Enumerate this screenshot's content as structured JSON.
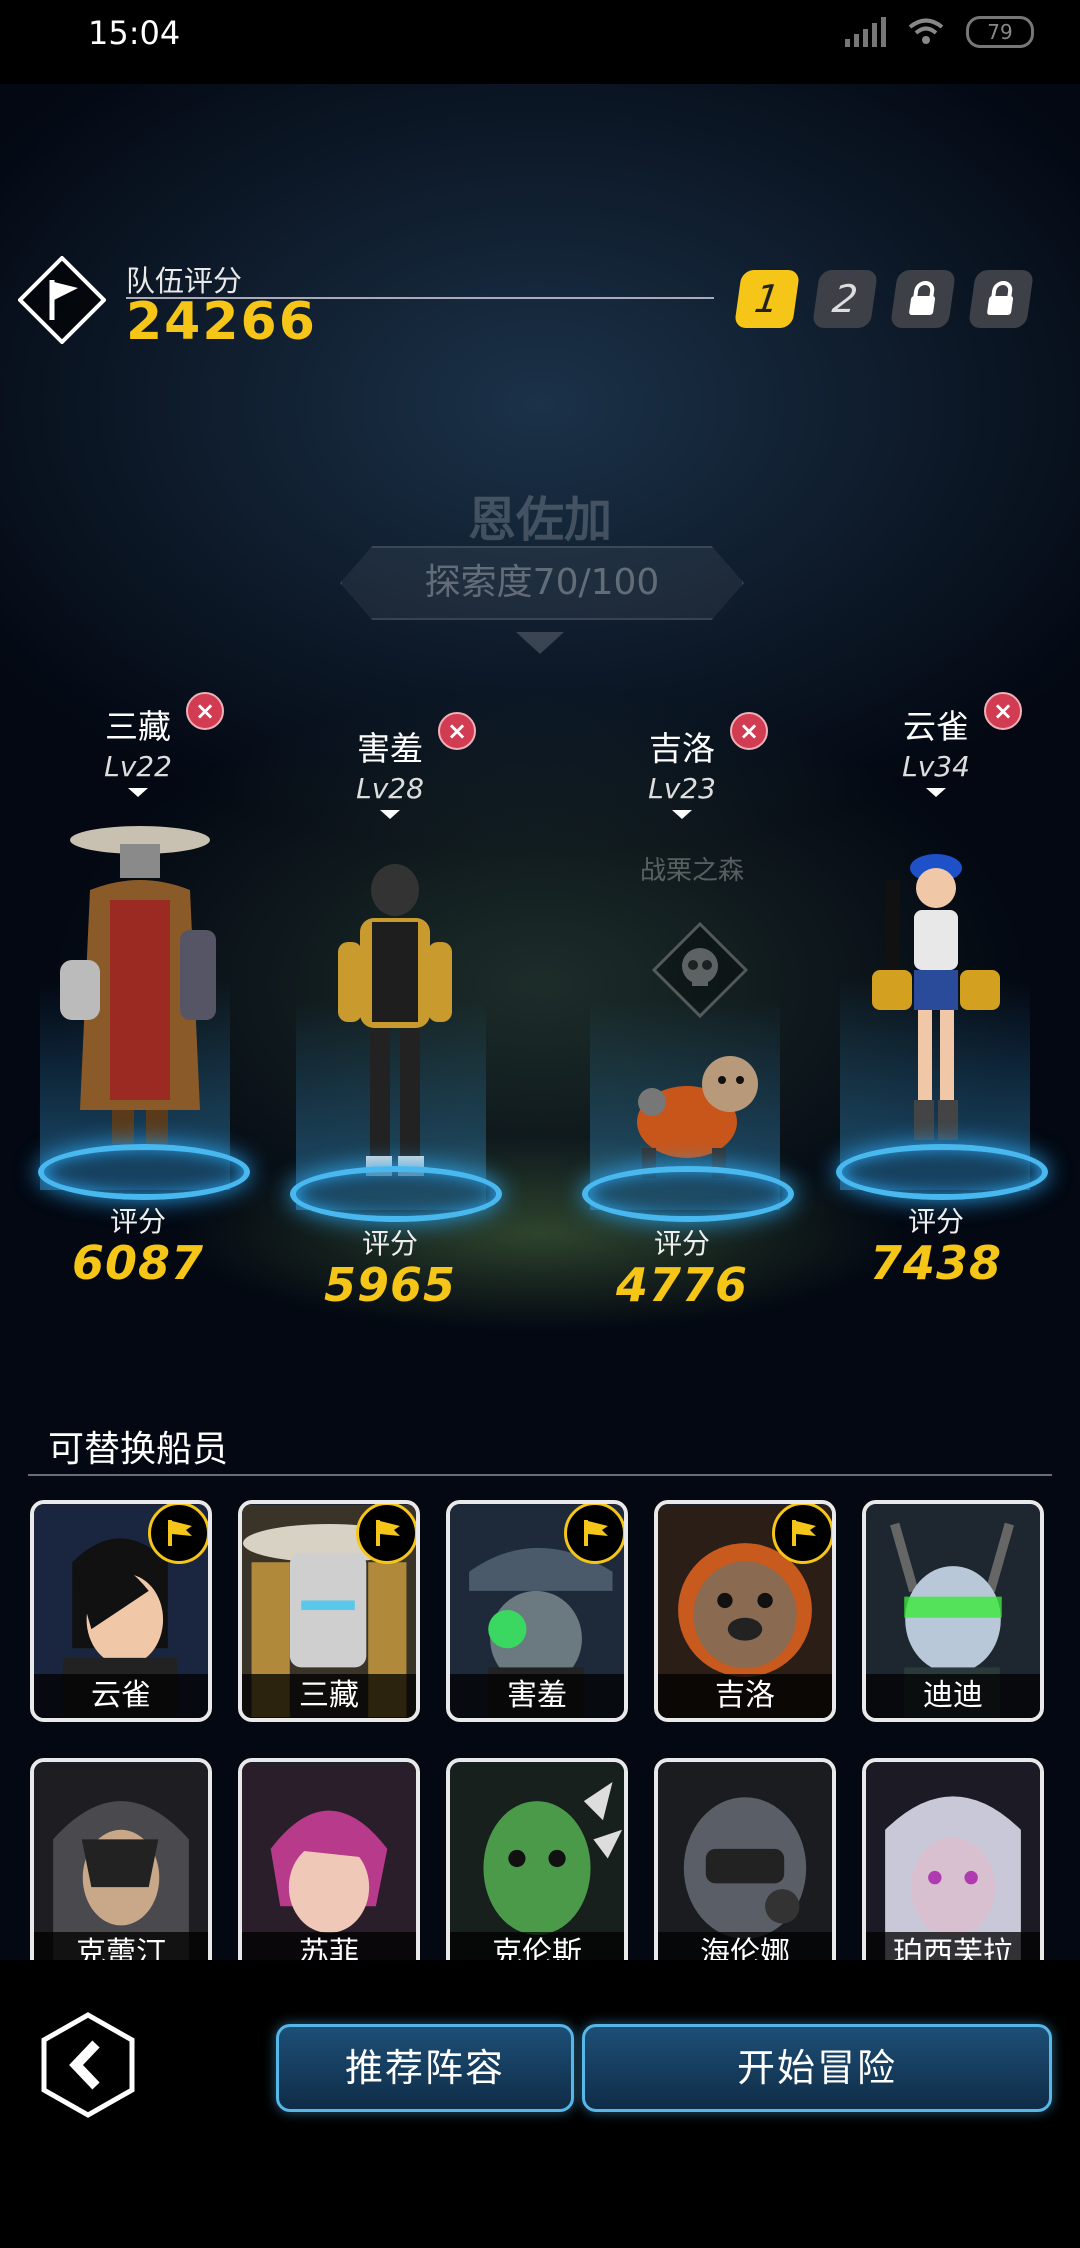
{
  "status_bar": {
    "time": "15:04",
    "battery": "79"
  },
  "team": {
    "label": "队伍评分",
    "score": "24266"
  },
  "team_slots": [
    {
      "label": "1",
      "state": "active"
    },
    {
      "label": "2",
      "state": "available"
    },
    {
      "label": "",
      "state": "locked",
      "icon": "lock-icon"
    },
    {
      "label": "",
      "state": "locked",
      "icon": "lock-icon"
    }
  ],
  "map": {
    "location": "恩佐加",
    "exploration": "探索度70/100",
    "area_label": "战栗之森"
  },
  "members": [
    {
      "name": "三藏",
      "level": "Lv22",
      "score_label": "评分",
      "score": "6087"
    },
    {
      "name": "害羞",
      "level": "Lv28",
      "score_label": "评分",
      "score": "5965"
    },
    {
      "name": "吉洛",
      "level": "Lv23",
      "score_label": "评分",
      "score": "4776"
    },
    {
      "name": "云雀",
      "level": "Lv34",
      "score_label": "评分",
      "score": "7438"
    }
  ],
  "swap": {
    "title": "可替换船员",
    "crew": [
      {
        "name": "云雀",
        "in_team": true
      },
      {
        "name": "三藏",
        "in_team": true
      },
      {
        "name": "害羞",
        "in_team": true
      },
      {
        "name": "吉洛",
        "in_team": true
      },
      {
        "name": "迪迪",
        "in_team": false
      },
      {
        "name": "克蕾汀",
        "in_team": false
      },
      {
        "name": "苏菲",
        "in_team": false
      },
      {
        "name": "克伦斯",
        "in_team": false
      },
      {
        "name": "海伦娜",
        "in_team": false
      },
      {
        "name": "珀西芙拉",
        "in_team": false
      }
    ]
  },
  "buttons": {
    "recommend": "推荐阵容",
    "start": "开始冒险"
  },
  "colors": {
    "accent_gold": "#f5c518",
    "platform_blue": "#49b8ef",
    "remove_red": "#d23c52"
  }
}
